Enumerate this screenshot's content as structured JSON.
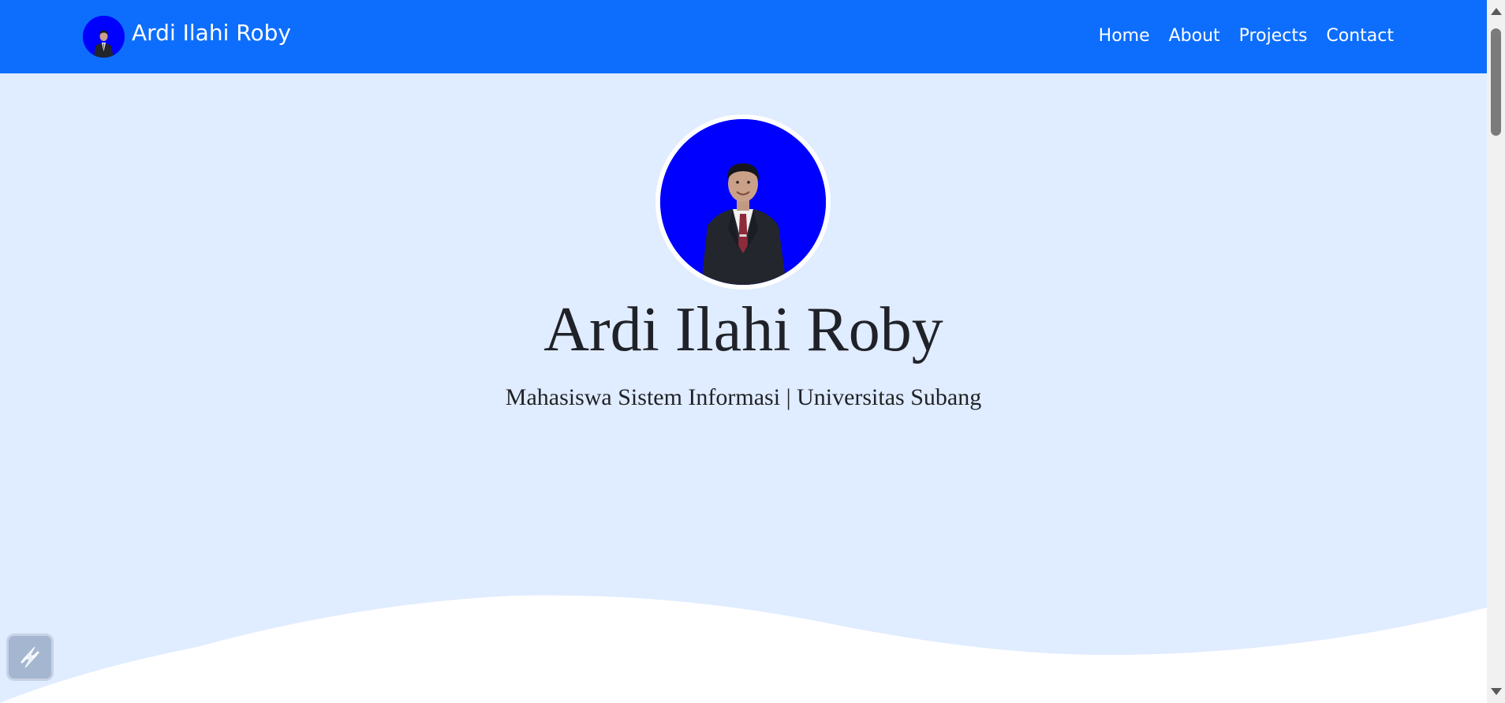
{
  "navbar": {
    "brand_name": "Ardi Ilahi Roby",
    "links": [
      {
        "label": "Home"
      },
      {
        "label": "About"
      },
      {
        "label": "Projects"
      },
      {
        "label": "Contact"
      }
    ],
    "background_color": "#0d6efd"
  },
  "hero": {
    "title": "Ardi Ilahi Roby",
    "subtitle": "Mahasiswa Sistem Informasi | Universitas Subang",
    "avatar_background": "#0000ff",
    "background_color": "#e0ecff"
  },
  "icons": {
    "float_widget": "lightning-bolt-icon"
  }
}
